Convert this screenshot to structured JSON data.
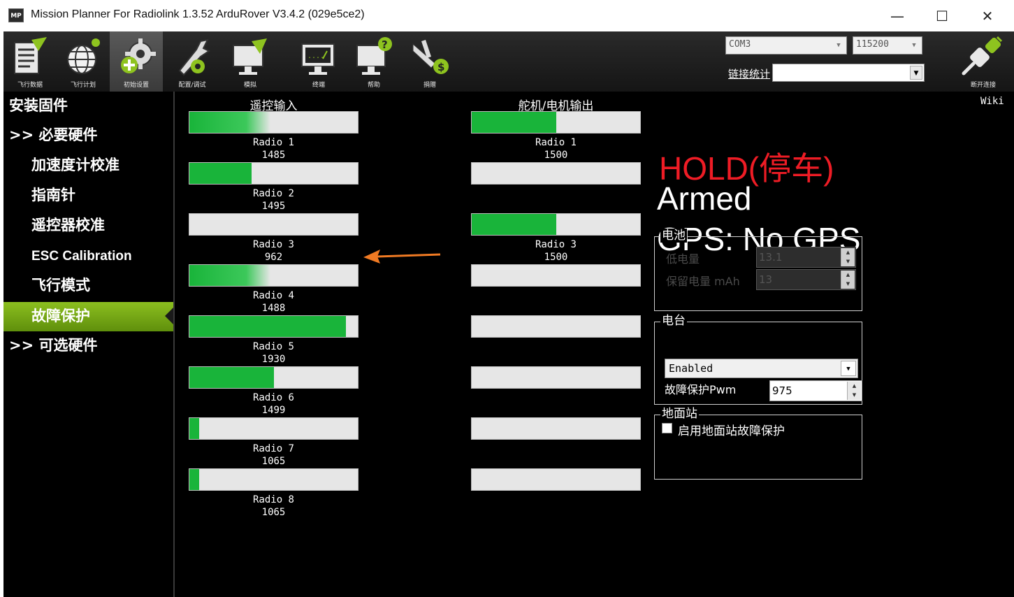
{
  "window": {
    "icon_text": "MP",
    "title": "Mission Planner For Radiolink 1.3.52 ArduRover V3.4.2 (029e5ce2)",
    "controls": [
      "minimize-icon",
      "maximize-icon",
      "close-icon"
    ],
    "minimize_glyph": "—",
    "maximize_glyph": "☐",
    "close_glyph": "✕"
  },
  "toolbar": {
    "buttons": [
      {
        "label": "飞行数据",
        "icon": "flight-data-icon"
      },
      {
        "label": "飞行计划",
        "icon": "flight-plan-icon"
      },
      {
        "label": "初始设置",
        "icon": "initial-setup-icon",
        "active": true
      },
      {
        "label": "配置/调试",
        "icon": "config-tuning-icon"
      },
      {
        "label": "模拟",
        "icon": "simulation-icon"
      },
      {
        "label": "终端",
        "icon": "terminal-icon"
      },
      {
        "label": "帮助",
        "icon": "help-icon"
      },
      {
        "label": "捐赠",
        "icon": "donate-icon"
      }
    ],
    "port": "COM3",
    "baud": "115200",
    "link_stats_label": "链接统计",
    "link_value": "",
    "disconnect_label": "断开连接"
  },
  "sidebar": {
    "items": [
      {
        "label": "安装固件",
        "kind": "top"
      },
      {
        "label": ">> 必要硬件",
        "kind": "top"
      },
      {
        "label": "加速度计校准",
        "kind": "sub"
      },
      {
        "label": "指南针",
        "kind": "sub"
      },
      {
        "label": "遥控器校准",
        "kind": "sub"
      },
      {
        "label": "ESC Calibration",
        "kind": "sub"
      },
      {
        "label": "飞行模式",
        "kind": "sub"
      },
      {
        "label": "故障保护",
        "kind": "sub",
        "active": true
      },
      {
        "label": ">> 可选硬件",
        "kind": "top"
      }
    ]
  },
  "content": {
    "wiki_label": "Wiki",
    "radio_in_title": "遥控输入",
    "servo_out_title": "舵机/电机输出",
    "radio_in": [
      {
        "name": "Radio 1",
        "value": "1485",
        "fill": 0.48
      },
      {
        "name": "Radio 2",
        "value": "1495",
        "fill": 0.37
      },
      {
        "name": "Radio 3",
        "value": "962",
        "fill": 0.0
      },
      {
        "name": "Radio 4",
        "value": "1488",
        "fill": 0.48
      },
      {
        "name": "Radio 5",
        "value": "1930",
        "fill": 0.93
      },
      {
        "name": "Radio 6",
        "value": "1499",
        "fill": 0.5
      },
      {
        "name": "Radio 7",
        "value": "1065",
        "fill": 0.06
      },
      {
        "name": "Radio 8",
        "value": "1065",
        "fill": 0.06
      }
    ],
    "servo_out": [
      {
        "name": "Radio 1",
        "value": "1500",
        "fill": 0.5
      },
      {
        "name": "",
        "value": "",
        "fill": 0.0
      },
      {
        "name": "Radio 3",
        "value": "1500",
        "fill": 0.5
      },
      {
        "name": "",
        "value": "",
        "fill": 0.0
      },
      {
        "name": "",
        "value": "",
        "fill": 0.0
      },
      {
        "name": "",
        "value": "",
        "fill": 0.0
      },
      {
        "name": "",
        "value": "",
        "fill": 0.0
      },
      {
        "name": "",
        "value": "",
        "fill": 0.0
      }
    ],
    "mode": "HOLD(停车)",
    "armed": "Armed",
    "gps": "GPS: No GPS",
    "battery": {
      "title": "电池",
      "low_voltage_label": "低电量",
      "low_voltage_value": "13.1",
      "reserve_mah_label": "保留电量 mAh",
      "reserve_mah_value": "13"
    },
    "radio": {
      "title": "电台",
      "fs_enabled": "Enabled",
      "fs_pwm_label": "故障保护Pwm",
      "fs_pwm_value": "975"
    },
    "gcs": {
      "title": "地面站",
      "enable_label": "启用地面站故障保护",
      "checked": false
    }
  },
  "colors": {
    "active_menu": "#7fb31a",
    "bar_fill": "#19b43a",
    "mode_red": "#ee1c25",
    "annotation_arrow": "#f07a23"
  }
}
